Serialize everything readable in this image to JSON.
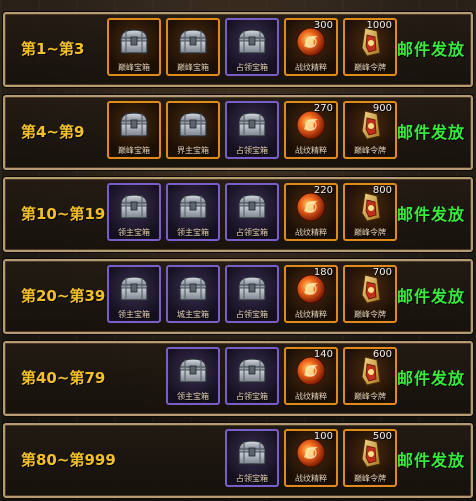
{
  "icons": {
    "chest": "chest-icon",
    "rune": "rune-essence-icon",
    "token": "peak-token-icon"
  },
  "colors": {
    "rank": "#f3c02a",
    "mail": "#36ec3a",
    "rare_border": "#7a5ec8",
    "epic_border": "#e08a1a"
  },
  "tiers": [
    {
      "rank": "第1~第3",
      "mail": "邮件发放",
      "items": [
        {
          "label": "巅峰宝箱",
          "type": "chest",
          "rarity": "gold",
          "count": ""
        },
        {
          "label": "巅峰宝箱",
          "type": "chest",
          "rarity": "gold",
          "count": ""
        },
        {
          "label": "占领宝箱",
          "type": "chest",
          "rarity": "purple",
          "count": ""
        },
        {
          "label": "战纹精粹",
          "type": "rune",
          "rarity": "gold",
          "count": "300"
        },
        {
          "label": "巅峰令牌",
          "type": "token",
          "rarity": "gold",
          "count": "1000"
        }
      ]
    },
    {
      "rank": "第4~第9",
      "mail": "邮件发放",
      "items": [
        {
          "label": "巅峰宝箱",
          "type": "chest",
          "rarity": "gold",
          "count": ""
        },
        {
          "label": "界主宝箱",
          "type": "chest",
          "rarity": "gold",
          "count": ""
        },
        {
          "label": "占领宝箱",
          "type": "chest",
          "rarity": "purple",
          "count": ""
        },
        {
          "label": "战纹精粹",
          "type": "rune",
          "rarity": "gold",
          "count": "270"
        },
        {
          "label": "巅峰令牌",
          "type": "token",
          "rarity": "gold",
          "count": "900"
        }
      ]
    },
    {
      "rank": "第10~第19",
      "mail": "邮件发放",
      "items": [
        {
          "label": "领主宝箱",
          "type": "chest",
          "rarity": "purple",
          "count": ""
        },
        {
          "label": "领主宝箱",
          "type": "chest",
          "rarity": "purple",
          "count": ""
        },
        {
          "label": "占领宝箱",
          "type": "chest",
          "rarity": "purple",
          "count": ""
        },
        {
          "label": "战纹精粹",
          "type": "rune",
          "rarity": "gold",
          "count": "220"
        },
        {
          "label": "巅峰令牌",
          "type": "token",
          "rarity": "gold",
          "count": "800"
        }
      ]
    },
    {
      "rank": "第20~第39",
      "mail": "邮件发放",
      "items": [
        {
          "label": "领主宝箱",
          "type": "chest",
          "rarity": "purple",
          "count": ""
        },
        {
          "label": "城主宝箱",
          "type": "chest",
          "rarity": "purple",
          "count": ""
        },
        {
          "label": "占领宝箱",
          "type": "chest",
          "rarity": "purple",
          "count": ""
        },
        {
          "label": "战纹精粹",
          "type": "rune",
          "rarity": "gold",
          "count": "180"
        },
        {
          "label": "巅峰令牌",
          "type": "token",
          "rarity": "gold",
          "count": "700"
        }
      ]
    },
    {
      "rank": "第40~第79",
      "mail": "邮件发放",
      "items": [
        {
          "label": "领主宝箱",
          "type": "chest",
          "rarity": "purple",
          "count": ""
        },
        {
          "label": "占领宝箱",
          "type": "chest",
          "rarity": "purple",
          "count": ""
        },
        {
          "label": "战纹精粹",
          "type": "rune",
          "rarity": "gold",
          "count": "140"
        },
        {
          "label": "巅峰令牌",
          "type": "token",
          "rarity": "gold",
          "count": "600"
        }
      ]
    },
    {
      "rank": "第80~第999",
      "mail": "邮件发放",
      "items": [
        {
          "label": "占领宝箱",
          "type": "chest",
          "rarity": "purple",
          "count": ""
        },
        {
          "label": "战纹精粹",
          "type": "rune",
          "rarity": "gold",
          "count": "100"
        },
        {
          "label": "巅峰令牌",
          "type": "token",
          "rarity": "gold",
          "count": "500"
        }
      ]
    }
  ]
}
